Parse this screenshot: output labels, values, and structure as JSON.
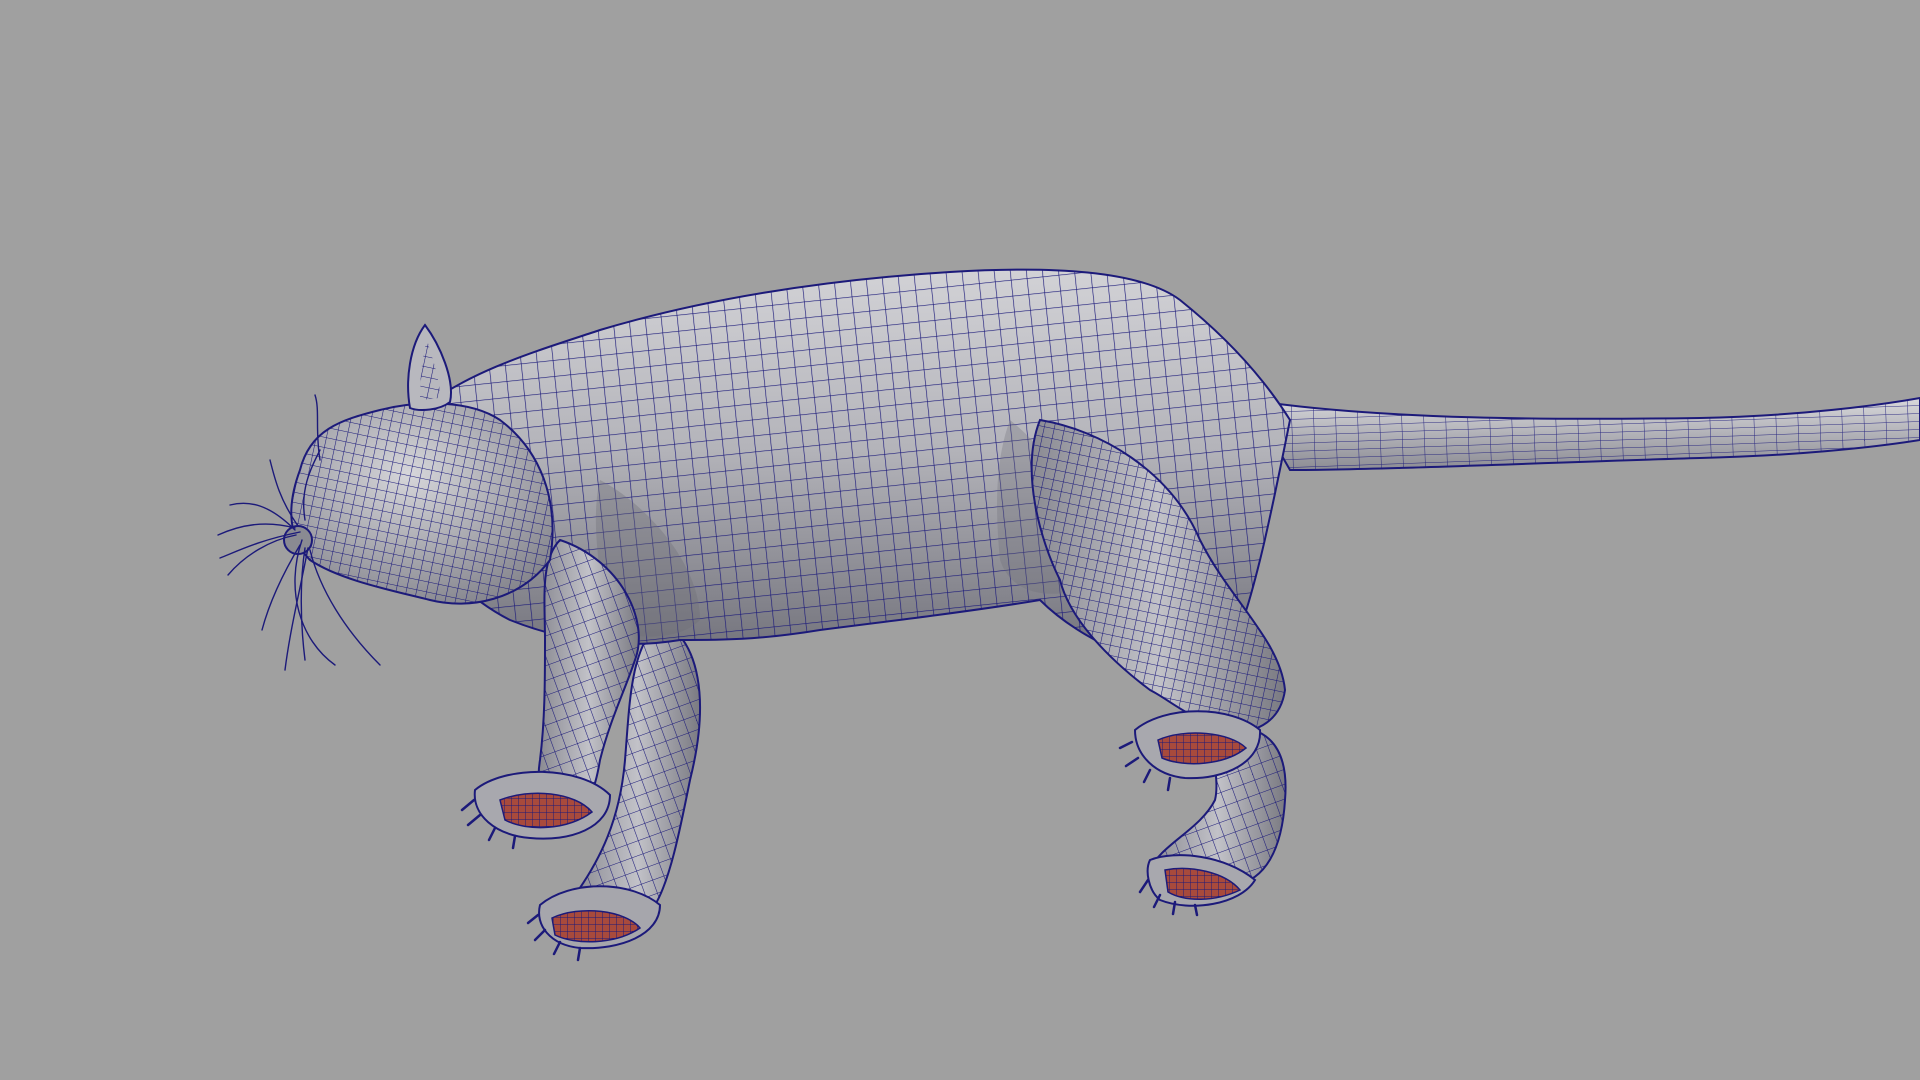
{
  "viewport": {
    "background_color": "#a0a0a0",
    "wire_color": "#1c1a7a",
    "surface_light": "#cfcfd3",
    "surface_mid": "#a6a6ac",
    "surface_dark": "#6e6e76",
    "paw_pad_color": "#b04a3a",
    "subject": "rat-wireframe-mesh"
  }
}
